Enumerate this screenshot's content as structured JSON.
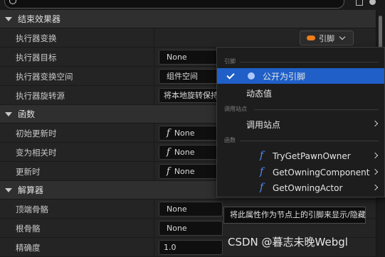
{
  "top": {
    "search_icon": "search-icon"
  },
  "sections": {
    "end_effector": {
      "title": "结束效果器",
      "rows": {
        "transform": {
          "label": "执行器变换",
          "pin_value": "引脚"
        },
        "target": {
          "label": "执行器目标",
          "value": "None"
        },
        "transform_space": {
          "label": "执行器变换空间",
          "value": "组件空间"
        },
        "rotation_source": {
          "label": "执行器旋转源",
          "value": "将本地旋转保持"
        }
      }
    },
    "functions": {
      "title": "函数",
      "rows": {
        "on_initial_update": {
          "label": "初始更新时",
          "value": "None"
        },
        "on_become_relevant": {
          "label": "变为相关时",
          "value": "None"
        },
        "on_update": {
          "label": "更新时",
          "value": "None"
        }
      }
    },
    "solver": {
      "title": "解算器",
      "rows": {
        "tip_bone": {
          "label": "顶端骨骼",
          "value": "None"
        },
        "root_bone": {
          "label": "根骨骼",
          "value": "None"
        },
        "precision": {
          "label": "精确度",
          "value": "1.0"
        }
      }
    }
  },
  "popup": {
    "cat_pin": "引脚",
    "expose_as_pin": "公开为引脚",
    "dynamic_value": "动态值",
    "cat_call_site": "调用站点",
    "call_site": "调用站点",
    "cat_function": "函数",
    "functions": [
      "TryGetPawnOwner",
      "GetOwningComponent",
      "GetOwningActor"
    ]
  },
  "tooltip": "将此属性作为节点上的引脚来显示/隐藏",
  "watermark": "CSDN @暮志未晚Webgl",
  "colors": {
    "accent_pin": "#f07e18",
    "selection": "#1f5fc7",
    "function_icon": "#4c8cff"
  }
}
